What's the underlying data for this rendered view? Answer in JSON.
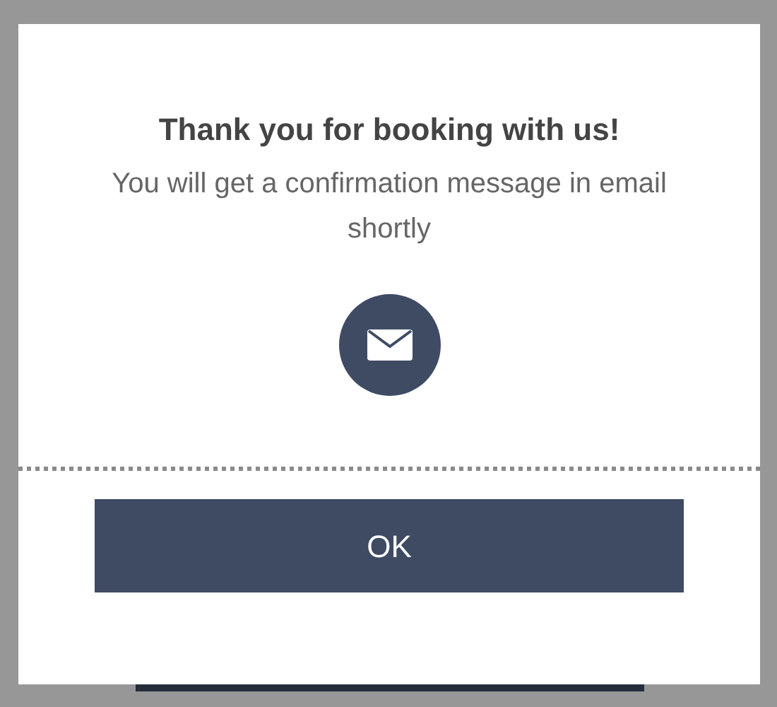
{
  "dialog": {
    "title": "Thank you for booking with us!",
    "message": "You will get a confirmation message in email shortly",
    "button": "OK"
  }
}
